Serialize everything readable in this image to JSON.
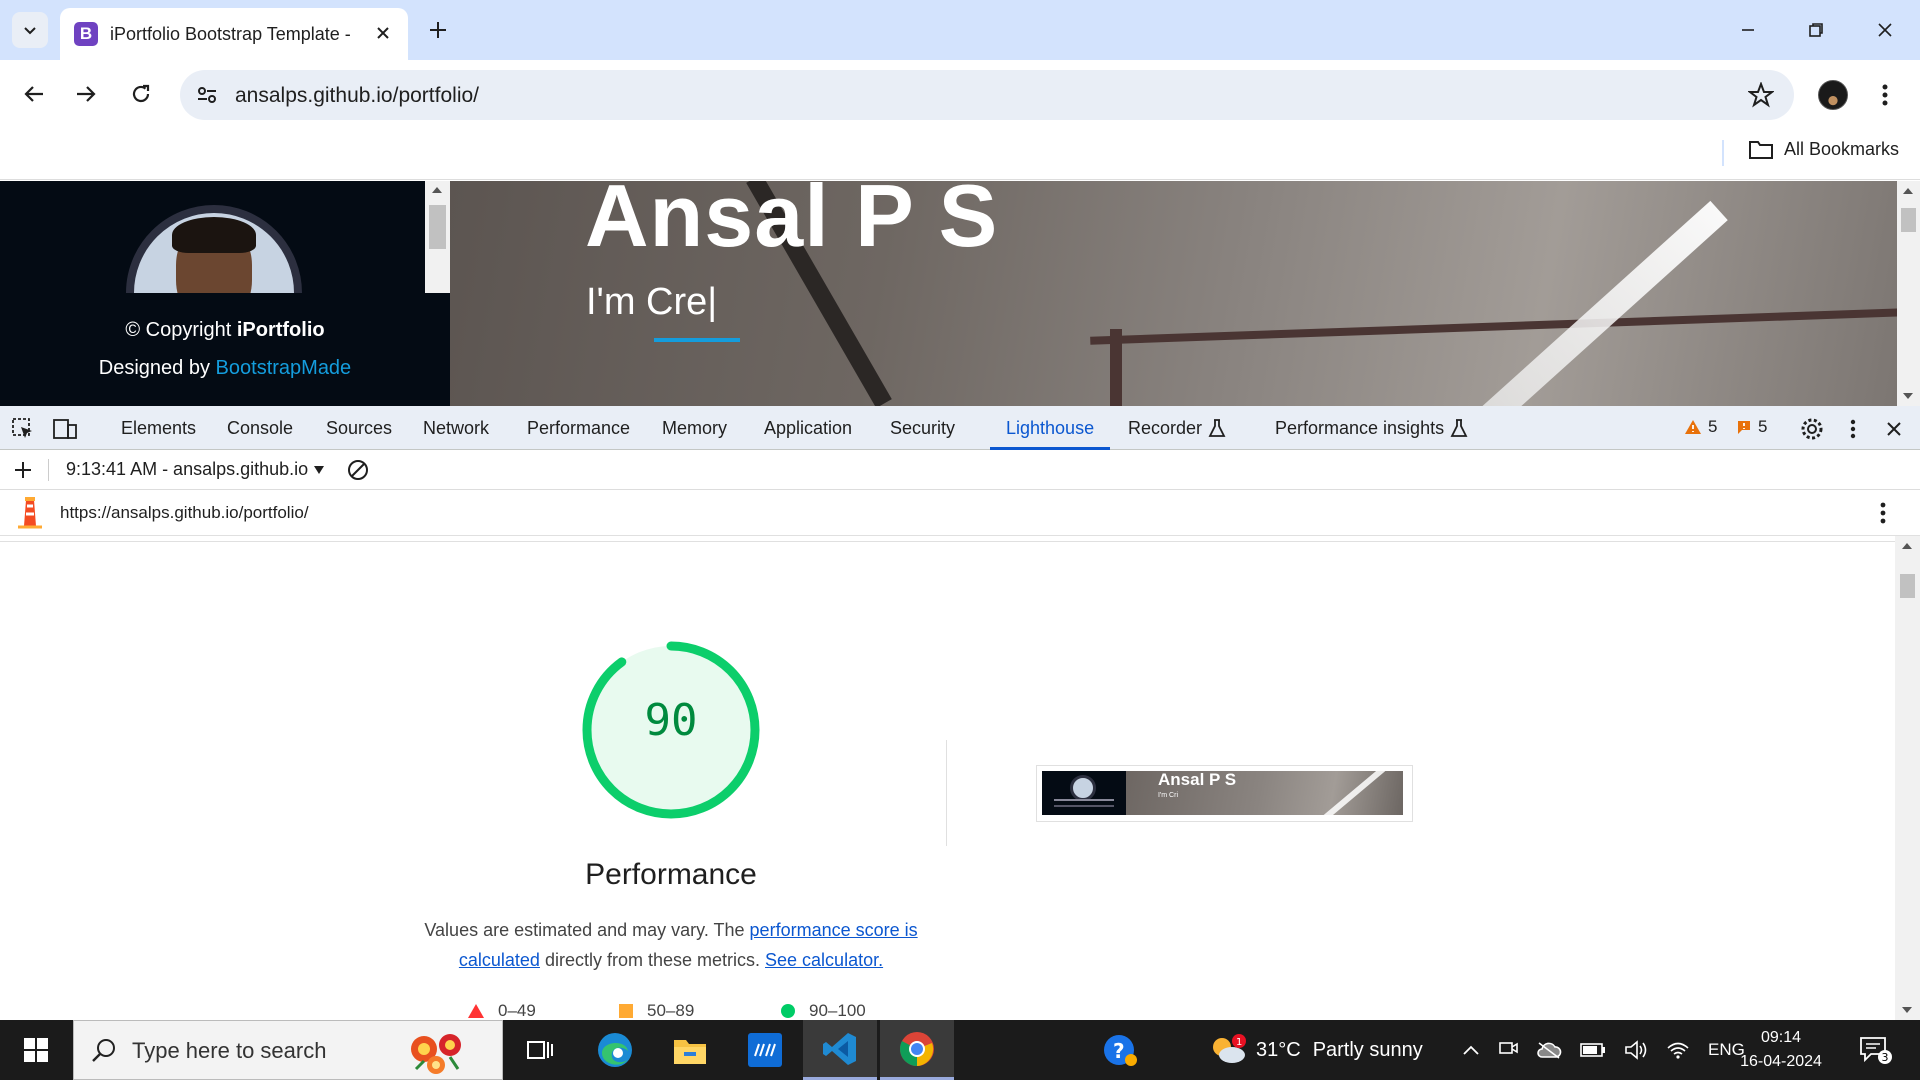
{
  "browser": {
    "tab_title": "iPortfolio Bootstrap Template - ",
    "tab_favicon_letter": "B",
    "url": "ansalps.github.io/portfolio/",
    "bookmarks_label": "All Bookmarks"
  },
  "page": {
    "copyright_prefix": "© Copyright ",
    "copyright_brand": "iPortfolio",
    "designed_prefix": "Designed by ",
    "designed_link": "BootstrapMade",
    "hero_name": "Ansal P S",
    "hero_subtitle": "I'm Cre|"
  },
  "devtools": {
    "tabs": [
      "Elements",
      "Console",
      "Sources",
      "Network",
      "Performance",
      "Memory",
      "Application",
      "Security",
      "Lighthouse",
      "Recorder",
      "Performance insights"
    ],
    "active_tab": "Lighthouse",
    "warnings_count": "5",
    "issues_count": "5",
    "report_select": "9:13:41 AM - ansalps.github.io",
    "report_url": "https://ansalps.github.io/portfolio/"
  },
  "lighthouse": {
    "score": "90",
    "score_fraction": 0.9,
    "score_color": "#0cce6b",
    "category": "Performance",
    "desc_text_1": "Values are estimated and may vary. The ",
    "desc_link_1": "performance score is calculated",
    "desc_text_2": " directly from these metrics. ",
    "desc_link_2": "See calculator.",
    "thumbnail_name": "Ansal P S",
    "thumbnail_sub": "I'm Cri",
    "legend": [
      {
        "range": "0–49",
        "color": "#ff3333"
      },
      {
        "range": "50–89",
        "color": "#ffaa33"
      },
      {
        "range": "90–100",
        "color": "#00cc66"
      }
    ]
  },
  "taskbar": {
    "search_placeholder": "Type here to search",
    "weather_temp": "31°C",
    "weather_desc": "Partly sunny",
    "weather_badge": "1",
    "language": "ENG",
    "time": "09:14",
    "date": "16-04-2024",
    "notification_count": "3"
  }
}
